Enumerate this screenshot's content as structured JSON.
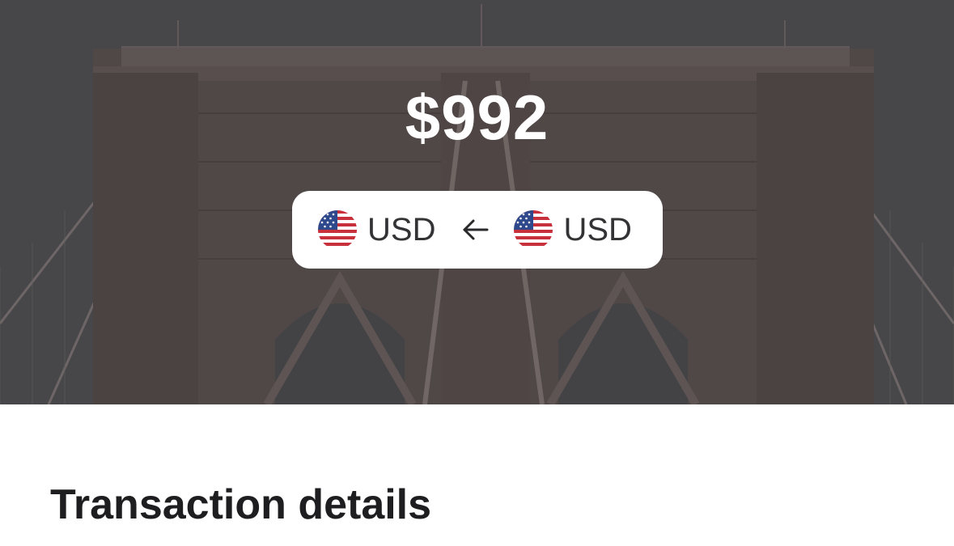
{
  "hero": {
    "amount": "$992",
    "background_image": "brooklyn-bridge-photo"
  },
  "currency_pill": {
    "from_code": "USD",
    "from_flag_icon": "us-flag-icon",
    "to_code": "USD",
    "to_flag_icon": "us-flag-icon",
    "swap_icon": "arrow-left-icon"
  },
  "details": {
    "title": "Transaction details"
  },
  "colors": {
    "title": "#1e1e20",
    "amount": "#ffffff",
    "pill_bg": "#ffffff",
    "currency_text": "#333336"
  }
}
